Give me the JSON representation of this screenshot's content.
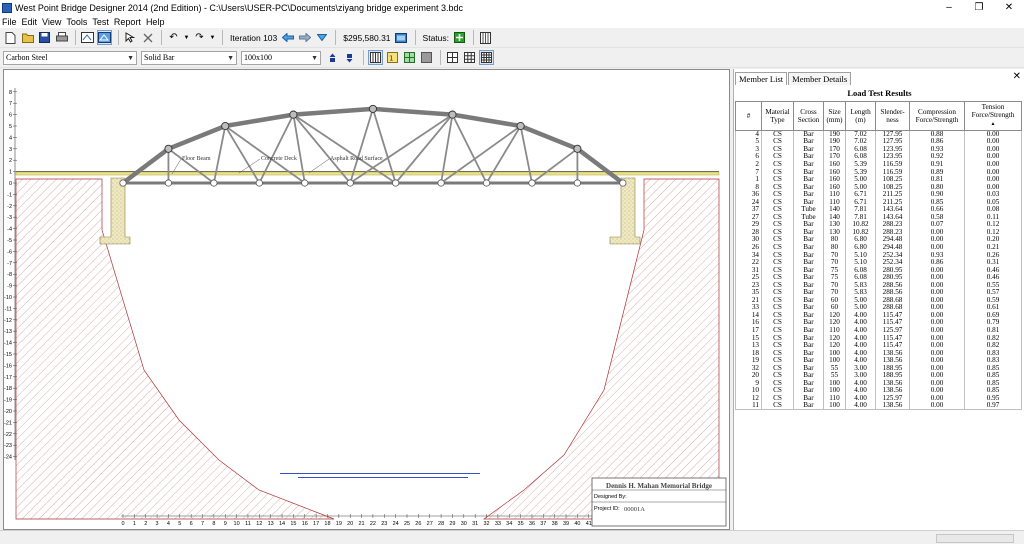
{
  "window": {
    "title": "West Point Bridge Designer 2014 (2nd Edition) - C:\\Users\\USER-PC\\Documents\\ziyang bridge experiment 3.bdc"
  },
  "menu": [
    "File",
    "Edit",
    "View",
    "Tools",
    "Test",
    "Report",
    "Help"
  ],
  "toolbar": {
    "iteration_label": "Iteration 103",
    "cost": "$295,580.31",
    "status_label": "Status:",
    "material": "Carbon Steel",
    "cross_section": "Solid Bar",
    "size": "100x100"
  },
  "drawing": {
    "labels": {
      "floor_beam": "Floor Beam",
      "concrete_deck": "Concrete Deck",
      "asphalt_surface": "Asphalt Road Surface"
    },
    "y_ticks": [
      "8",
      "7",
      "6",
      "5",
      "4",
      "3",
      "2",
      "1",
      "0",
      "-1",
      "-2",
      "-3",
      "-4",
      "-5",
      "-6",
      "-7",
      "-8",
      "-9",
      "-10",
      "-11",
      "-12",
      "-13",
      "-14",
      "-15",
      "-16",
      "-17",
      "-18",
      "-19",
      "-20",
      "-21",
      "-22",
      "-23",
      "-24"
    ],
    "x_ticks": [
      "0",
      "1",
      "2",
      "3",
      "4",
      "5",
      "6",
      "7",
      "8",
      "9",
      "10",
      "11",
      "12",
      "13",
      "14",
      "15",
      "16",
      "17",
      "18",
      "19",
      "20",
      "21",
      "22",
      "23",
      "24",
      "25",
      "26",
      "27",
      "28",
      "29",
      "30",
      "31",
      "32",
      "33",
      "34",
      "35",
      "36",
      "37",
      "38",
      "39",
      "40",
      "41",
      "42",
      "43",
      "44"
    ],
    "title_block": {
      "name": "Dennis H. Mahan Memorial Bridge",
      "designed_by": "Designed By:",
      "project_id": "Project ID:",
      "project_value": "00001A"
    }
  },
  "panel": {
    "tabs": [
      "Member List",
      "Member Details"
    ],
    "title": "Load  Test Results",
    "headers": [
      "#",
      "Material Type",
      "Cross Section",
      "Size (mm)",
      "Length (m)",
      "Slender-ness",
      "Compression Force/Strength",
      "Tension Force/Strength"
    ],
    "rows": [
      [
        "4",
        "CS",
        "Bar",
        "190",
        "7.02",
        "127.95",
        "0.88",
        "0.00"
      ],
      [
        "5",
        "CS",
        "Bar",
        "190",
        "7.02",
        "127.95",
        "0.86",
        "0.00"
      ],
      [
        "3",
        "CS",
        "Bar",
        "170",
        "6.08",
        "123.95",
        "0.93",
        "0.00"
      ],
      [
        "6",
        "CS",
        "Bar",
        "170",
        "6.08",
        "123.95",
        "0.92",
        "0.00"
      ],
      [
        "2",
        "CS",
        "Bar",
        "160",
        "5.39",
        "116.59",
        "0.91",
        "0.00"
      ],
      [
        "7",
        "CS",
        "Bar",
        "160",
        "5.39",
        "116.59",
        "0.89",
        "0.00"
      ],
      [
        "1",
        "CS",
        "Bar",
        "160",
        "5.00",
        "108.25",
        "0.81",
        "0.00"
      ],
      [
        "8",
        "CS",
        "Bar",
        "160",
        "5.00",
        "108.25",
        "0.80",
        "0.00"
      ],
      [
        "36",
        "CS",
        "Bar",
        "110",
        "6.71",
        "211.25",
        "0.90",
        "0.03"
      ],
      [
        "24",
        "CS",
        "Bar",
        "110",
        "6.71",
        "211.25",
        "0.85",
        "0.05"
      ],
      [
        "37",
        "CS",
        "Tube",
        "140",
        "7.81",
        "143.64",
        "0.66",
        "0.08"
      ],
      [
        "27",
        "CS",
        "Tube",
        "140",
        "7.81",
        "143.64",
        "0.58",
        "0.11"
      ],
      [
        "29",
        "CS",
        "Bar",
        "130",
        "10.82",
        "288.23",
        "0.07",
        "0.12"
      ],
      [
        "28",
        "CS",
        "Bar",
        "130",
        "10.82",
        "288.23",
        "0.00",
        "0.12"
      ],
      [
        "30",
        "CS",
        "Bar",
        "80",
        "6.80",
        "294.48",
        "0.00",
        "0.20"
      ],
      [
        "26",
        "CS",
        "Bar",
        "80",
        "6.80",
        "294.48",
        "0.00",
        "0.21"
      ],
      [
        "34",
        "CS",
        "Bar",
        "70",
        "5.10",
        "252.34",
        "0.93",
        "0.26"
      ],
      [
        "22",
        "CS",
        "Bar",
        "70",
        "5.10",
        "252.34",
        "0.86",
        "0.31"
      ],
      [
        "31",
        "CS",
        "Bar",
        "75",
        "6.08",
        "280.95",
        "0.00",
        "0.46"
      ],
      [
        "25",
        "CS",
        "Bar",
        "75",
        "6.08",
        "280.95",
        "0.00",
        "0.46"
      ],
      [
        "23",
        "CS",
        "Bar",
        "70",
        "5.83",
        "288.56",
        "0.00",
        "0.55"
      ],
      [
        "35",
        "CS",
        "Bar",
        "70",
        "5.83",
        "288.56",
        "0.00",
        "0.57"
      ],
      [
        "21",
        "CS",
        "Bar",
        "60",
        "5.00",
        "288.68",
        "0.00",
        "0.59"
      ],
      [
        "33",
        "CS",
        "Bar",
        "60",
        "5.00",
        "288.68",
        "0.00",
        "0.61"
      ],
      [
        "14",
        "CS",
        "Bar",
        "120",
        "4.00",
        "115.47",
        "0.00",
        "0.69"
      ],
      [
        "16",
        "CS",
        "Bar",
        "120",
        "4.00",
        "115.47",
        "0.00",
        "0.79"
      ],
      [
        "17",
        "CS",
        "Bar",
        "110",
        "4.00",
        "125.97",
        "0.00",
        "0.81"
      ],
      [
        "15",
        "CS",
        "Bar",
        "120",
        "4.00",
        "115.47",
        "0.00",
        "0.82"
      ],
      [
        "13",
        "CS",
        "Bar",
        "120",
        "4.00",
        "115.47",
        "0.00",
        "0.82"
      ],
      [
        "18",
        "CS",
        "Bar",
        "100",
        "4.00",
        "138.56",
        "0.00",
        "0.83"
      ],
      [
        "19",
        "CS",
        "Bar",
        "100",
        "4.00",
        "138.56",
        "0.00",
        "0.83"
      ],
      [
        "32",
        "CS",
        "Bar",
        "55",
        "3.00",
        "188.95",
        "0.00",
        "0.85"
      ],
      [
        "20",
        "CS",
        "Bar",
        "55",
        "3.00",
        "188.95",
        "0.00",
        "0.85"
      ],
      [
        "9",
        "CS",
        "Bar",
        "100",
        "4.00",
        "138.56",
        "0.00",
        "0.85"
      ],
      [
        "10",
        "CS",
        "Bar",
        "100",
        "4.00",
        "138.56",
        "0.00",
        "0.85"
      ],
      [
        "12",
        "CS",
        "Bar",
        "110",
        "4.00",
        "125.97",
        "0.00",
        "0.95"
      ],
      [
        "11",
        "CS",
        "Bar",
        "100",
        "4.00",
        "138.56",
        "0.00",
        "0.97"
      ]
    ]
  }
}
